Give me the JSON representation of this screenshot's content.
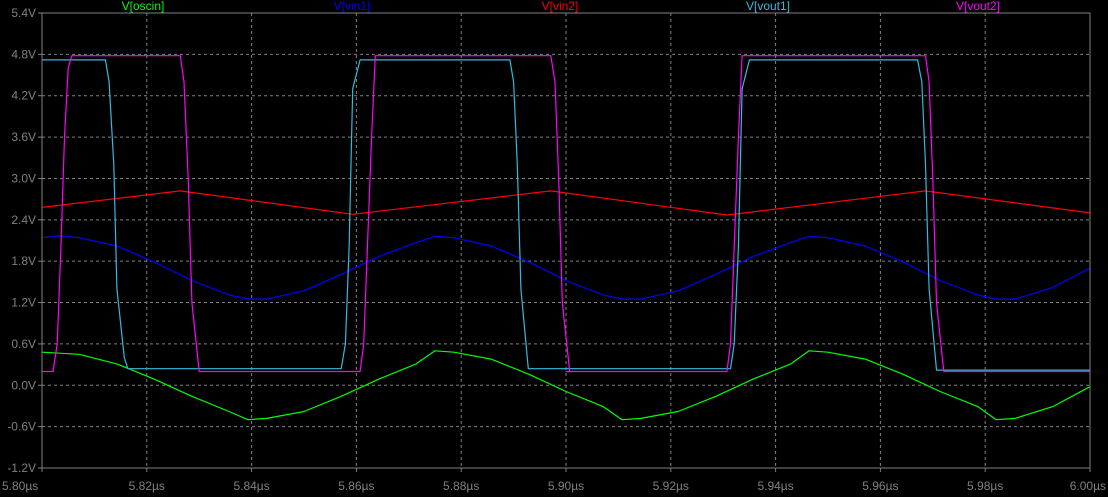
{
  "chart_data": {
    "type": "line",
    "x_unit": "µs",
    "x_ticks": [
      "5.80µs",
      "5.82µs",
      "5.84µs",
      "5.86µs",
      "5.88µs",
      "5.90µs",
      "5.92µs",
      "5.94µs",
      "5.96µs",
      "5.98µs",
      "6.00µs"
    ],
    "y_ticks": [
      "-1.2V",
      "-0.6V",
      "0.0V",
      "0.6V",
      "1.2V",
      "1.8V",
      "2.4V",
      "3.0V",
      "3.6V",
      "4.2V",
      "4.8V",
      "5.4V"
    ],
    "xlim": [
      5.8,
      6.0
    ],
    "ylim": [
      -1.2,
      5.4
    ],
    "grid": true,
    "legend_position": "top",
    "background": "#000000",
    "axis_color": "#808080",
    "grid_color": "#808080",
    "series": [
      {
        "name": "V[oscin]",
        "color": "#00ff00",
        "x": [
          5.8,
          5.8071,
          5.8143,
          5.8214,
          5.8286,
          5.8357,
          5.8393,
          5.8429,
          5.85,
          5.8571,
          5.8643,
          5.8714,
          5.875,
          5.8786,
          5.8857,
          5.8929,
          5.9,
          5.9071,
          5.9107,
          5.9143,
          5.9214,
          5.9286,
          5.9357,
          5.9429,
          5.9464,
          5.95,
          5.9571,
          5.9643,
          5.9714,
          5.9786,
          5.9821,
          5.9857,
          5.9929,
          6.0
        ],
        "y": [
          0.48,
          0.45,
          0.31,
          0.09,
          -0.16,
          -0.38,
          -0.5,
          -0.48,
          -0.38,
          -0.16,
          0.09,
          0.31,
          0.5,
          0.48,
          0.38,
          0.16,
          -0.09,
          -0.31,
          -0.5,
          -0.48,
          -0.38,
          -0.16,
          0.09,
          0.31,
          0.5,
          0.48,
          0.38,
          0.16,
          -0.09,
          -0.31,
          -0.5,
          -0.48,
          -0.31,
          -0.02
        ]
      },
      {
        "name": "V[vin1]",
        "color": "#0000ff",
        "x": [
          5.8,
          5.8036,
          5.8071,
          5.8143,
          5.8214,
          5.8286,
          5.8357,
          5.8393,
          5.8429,
          5.85,
          5.8571,
          5.8643,
          5.8714,
          5.875,
          5.8786,
          5.8857,
          5.8929,
          5.9,
          5.9071,
          5.9107,
          5.9143,
          5.9214,
          5.9286,
          5.9357,
          5.9429,
          5.9464,
          5.95,
          5.9571,
          5.9643,
          5.9714,
          5.9786,
          5.9821,
          5.9857,
          5.9929,
          6.0
        ],
        "y": [
          2.14,
          2.17,
          2.14,
          2.02,
          1.79,
          1.52,
          1.31,
          1.25,
          1.25,
          1.37,
          1.61,
          1.87,
          2.07,
          2.16,
          2.14,
          2.02,
          1.79,
          1.52,
          1.31,
          1.25,
          1.25,
          1.37,
          1.61,
          1.87,
          2.07,
          2.16,
          2.14,
          2.02,
          1.79,
          1.52,
          1.31,
          1.25,
          1.25,
          1.42,
          1.7
        ]
      },
      {
        "name": "V[vin2]",
        "color": "#ff0000",
        "x": [
          5.8,
          5.8264,
          5.8593,
          5.8971,
          5.9307,
          5.9686,
          6.0
        ],
        "y": [
          2.58,
          2.82,
          2.48,
          2.82,
          2.47,
          2.82,
          2.5
        ]
      },
      {
        "name": "V[vout1]",
        "color": "#33bbdd",
        "x": [
          5.8,
          5.8121,
          5.8128,
          5.8137,
          5.8143,
          5.8157,
          5.8164,
          5.8571,
          5.8579,
          5.8586,
          5.8593,
          5.8607,
          5.8893,
          5.89,
          5.8907,
          5.8914,
          5.8928,
          5.9314,
          5.9321,
          5.9329,
          5.9336,
          5.935,
          5.9671,
          5.9679,
          5.9686,
          5.9693,
          5.9707,
          6.0
        ],
        "y": [
          4.72,
          4.72,
          4.4,
          3.2,
          1.4,
          0.4,
          0.24,
          0.24,
          0.6,
          2.0,
          4.3,
          4.72,
          4.72,
          4.4,
          3.2,
          1.4,
          0.24,
          0.24,
          0.6,
          2.0,
          4.3,
          4.72,
          4.72,
          4.4,
          3.2,
          1.4,
          0.22,
          0.22
        ]
      },
      {
        "name": "V[vout2]",
        "color": "#ff00ff",
        "x": [
          5.8,
          5.8021,
          5.8029,
          5.8036,
          5.8043,
          5.805,
          5.8057,
          5.8264,
          5.8271,
          5.8279,
          5.8286,
          5.83,
          5.8393,
          5.8607,
          5.8614,
          5.8621,
          5.8629,
          5.8636,
          5.8971,
          5.8979,
          5.8986,
          5.8993,
          5.9007,
          5.9,
          5.9307,
          5.9314,
          5.9321,
          5.9329,
          5.9336,
          5.9686,
          5.9693,
          5.97,
          5.9707,
          5.9721,
          6.0
        ],
        "y": [
          0.2,
          0.2,
          0.6,
          2.0,
          3.6,
          4.6,
          4.78,
          4.78,
          4.4,
          3.0,
          1.2,
          0.2,
          0.2,
          0.2,
          0.6,
          2.0,
          3.6,
          4.78,
          4.78,
          4.4,
          3.0,
          1.2,
          0.2,
          0.2,
          0.2,
          0.6,
          2.0,
          3.6,
          4.78,
          4.78,
          4.4,
          3.0,
          1.2,
          0.2,
          0.2
        ]
      }
    ]
  }
}
